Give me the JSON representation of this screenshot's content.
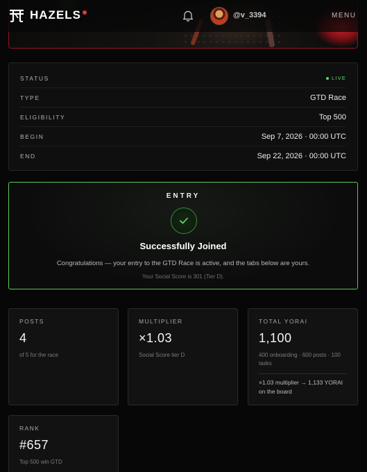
{
  "header": {
    "brand": "HAZELS",
    "username": "@v_3394",
    "menu_label": "MENU"
  },
  "info": {
    "rows": [
      {
        "label": "STATUS",
        "value": "LIVE"
      },
      {
        "label": "TYPE",
        "value": "GTD Race"
      },
      {
        "label": "ELIGIBILITY",
        "value": "Top 500"
      },
      {
        "label": "BEGIN",
        "value": "Sep 7, 2026 · 00:00 UTC"
      },
      {
        "label": "END",
        "value": "Sep 22, 2026 · 00:00 UTC"
      }
    ]
  },
  "entry": {
    "title": "ENTRY",
    "heading": "Successfully Joined",
    "message": "Congratulations — your entry to the GTD Race is active, and the tabs below are yours.",
    "note": "Your Social Score is 301 (Tier D)."
  },
  "stats": {
    "posts": {
      "label": "POSTS",
      "value": "4",
      "sub": "of 5 for the race"
    },
    "multiplier": {
      "label": "MULTIPLIER",
      "value": "×1.03",
      "sub": "Social Score tier D"
    },
    "total": {
      "label": "TOTAL YORAI",
      "value": "1,100",
      "sub": "400 onboarding · 600 posts · 100 tasks",
      "extra": "×1.03 multiplier → 1,133 YORAI on the board"
    },
    "rank": {
      "label": "RANK",
      "value": "#657",
      "sub": "Top 500 win GTD"
    }
  },
  "colors": {
    "accent_green": "#5cc95e",
    "live_green": "#5fd46a",
    "brand_red": "#e23a3a",
    "background": "#070707"
  }
}
